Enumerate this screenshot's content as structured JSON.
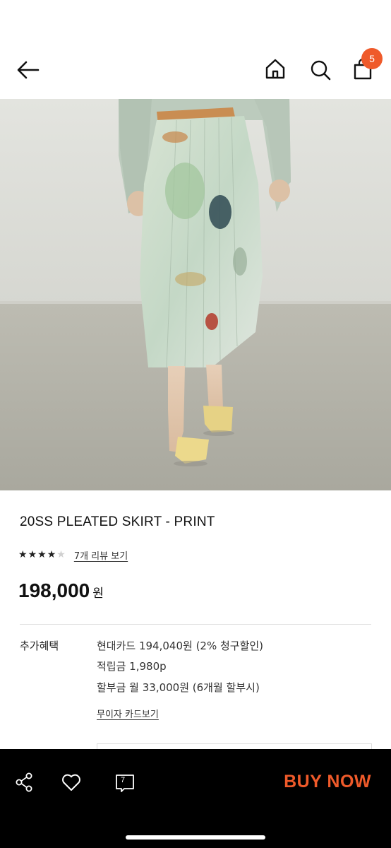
{
  "header": {
    "back_icon": "arrow-left-icon",
    "home_icon": "home-icon",
    "search_icon": "search-icon",
    "bag_icon": "shopping-bag-icon",
    "bag_count": "5",
    "accent_color": "#ef5a2a"
  },
  "product": {
    "title": "20SS PLEATED SKIRT - PRINT",
    "rating": 4,
    "rating_max": 5,
    "review_link": "7개 리뷰 보기",
    "price": "198,000",
    "price_unit": "원"
  },
  "benefits": {
    "label": "추가혜택",
    "lines": [
      "현대카드 194,040원 (2% 청구할인)",
      "적립금 1,980p",
      "할부금 월 33,000원 (6개월 할부시)"
    ],
    "card_link": "무이자 카드보기"
  },
  "bottom_bar": {
    "share_icon": "share-icon",
    "heart_icon": "heart-icon",
    "review_icon": "review-icon",
    "review_count": "7",
    "buy_label": "BUY NOW",
    "buy_color": "#ef5a2a"
  }
}
